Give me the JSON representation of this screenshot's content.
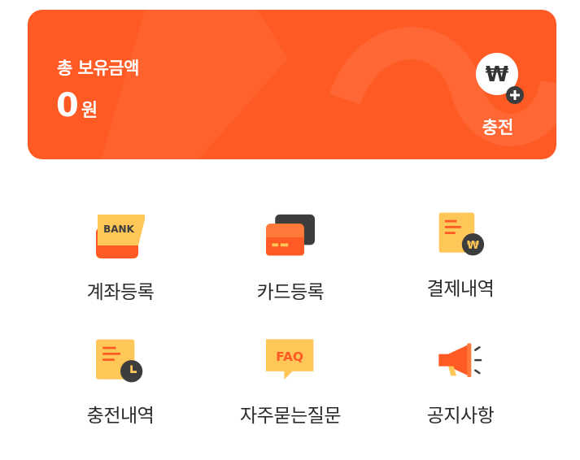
{
  "balance": {
    "title": "총 보유금액",
    "amount": "0",
    "unit": "원",
    "charge_label": "충전",
    "charge_icon": "won-plus-icon"
  },
  "menu": {
    "items": [
      {
        "label": "계좌등록",
        "icon": "bank-icon"
      },
      {
        "label": "카드등록",
        "icon": "card-icon"
      },
      {
        "label": "결제내역",
        "icon": "payment-history-icon",
        "badge": "₩"
      },
      {
        "label": "충전내역",
        "icon": "charge-history-icon"
      },
      {
        "label": "자주묻는질문",
        "icon": "faq-icon",
        "badge": "FAQ"
      },
      {
        "label": "공지사항",
        "icon": "megaphone-icon"
      }
    ],
    "bank_text": "BANK"
  },
  "colors": {
    "accent": "#ff5a24",
    "icon_orange": "#ff5a24",
    "icon_yellow": "#ffc658",
    "icon_dark": "#3d3d3d"
  }
}
